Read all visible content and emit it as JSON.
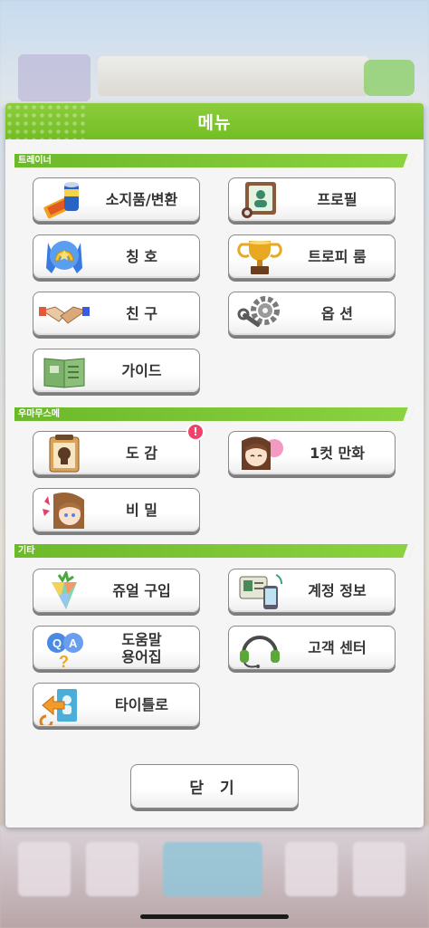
{
  "dialog": {
    "title": "메뉴",
    "close_label": "닫 기"
  },
  "sections": {
    "trainer": "트레이너",
    "umamusume": "우마무스메",
    "etc": "기타"
  },
  "buttons": {
    "items": "소지품/변환",
    "profile": "프로필",
    "title": "칭 호",
    "trophy": "트로피 룸",
    "friends": "친 구",
    "options": "옵 션",
    "guide": "가이드",
    "encyclopedia": "도 감",
    "comic": "1컷 만화",
    "secret": "비 밀",
    "jewel": "쥬얼 구입",
    "account": "계정 정보",
    "help": "도움말\n용어집",
    "support": "고객 센터",
    "totitle": "타이틀로"
  },
  "badges": {
    "encyclopedia": "!"
  },
  "colors": {
    "accent_green": "#7dc232",
    "badge_pink": "#f0426a"
  }
}
